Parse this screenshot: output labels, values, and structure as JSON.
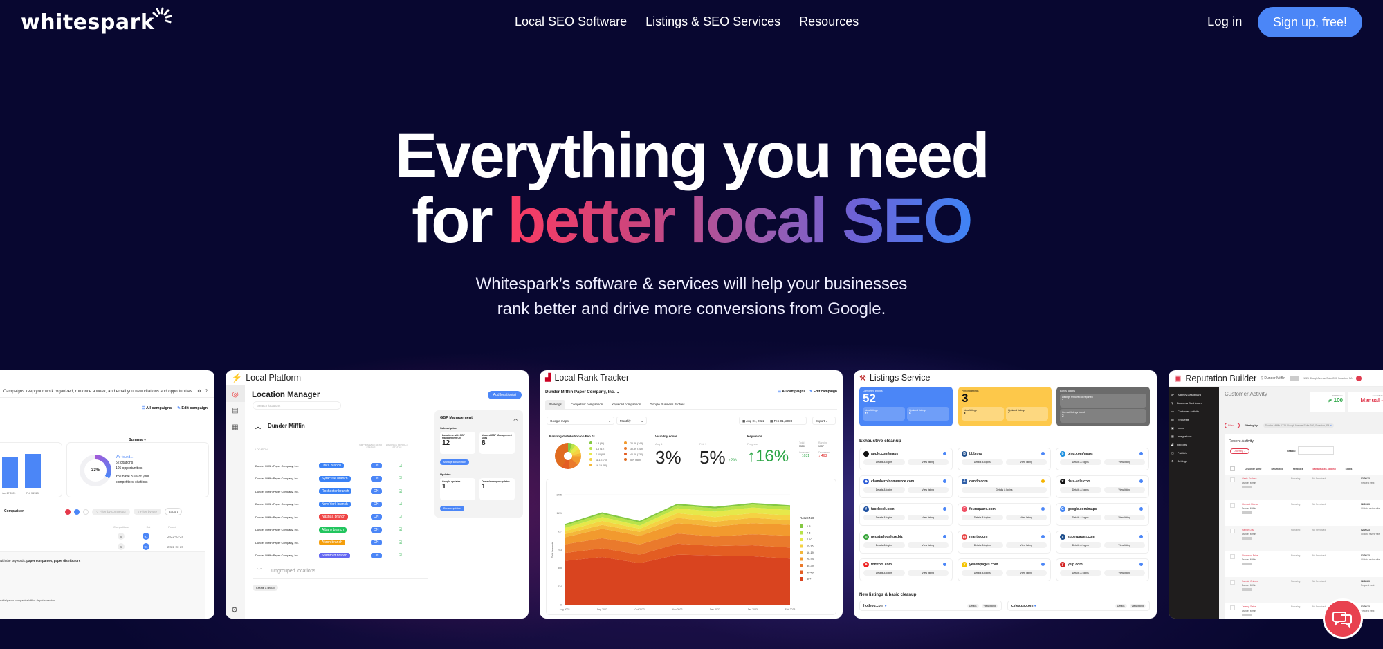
{
  "nav": {
    "logo": "whitespark",
    "menu": [
      "Local SEO Software",
      "Listings & SEO Services",
      "Resources"
    ],
    "login": "Log in",
    "signup": "Sign up, free!"
  },
  "hero": {
    "line1": "Everything you need",
    "line2_plain": "for",
    "line2_grad": "better local SEO",
    "subtitle_1": "Whitespark’s software & services will help your businesses",
    "subtitle_2": "rank better and drive more conversions from Google."
  },
  "colors": {
    "accent": "#4b86f7",
    "background": "#080730",
    "grad_start": "#fb3b62",
    "grad_end": "#3f84f6",
    "chat": "#e8414f"
  },
  "citation_card": {
    "info": "Campaigns keep your work organized, run once a week, and email you new citations and opportunities.",
    "all_campaigns": "All campaigns",
    "edit_campaign": "Edit campaign",
    "summary": "Summary",
    "bars": [
      {
        "label": "Jan 27 2023",
        "value": 47
      },
      {
        "label": "Feb 3 2023",
        "value": 52
      }
    ],
    "donut_pct": "33%",
    "found": "We found...",
    "citations": "52 citations",
    "opportunities": "105 opportunities",
    "compare_1": "You have 33% of your",
    "compare_2": "competitors' citations",
    "comparison": "Comparison",
    "filter_competitor": "Filter by competitor",
    "filter_site": "Filter by site",
    "export": "Export",
    "cols": [
      "Competitors",
      "DA",
      "Found"
    ],
    "rows": [
      {
        "competitors": "8",
        "da": "91",
        "found": "2022-03-28"
      },
      {
        "competitors": "6",
        "da": "91",
        "found": "2022-03-28"
      }
    ],
    "keywords_text": "with the keywords: ",
    "keywords": "paper companies, paper distributors",
    "url": "rofile/paper-companies/office-depot-scranton"
  },
  "local_platform": {
    "title": "Local Platform",
    "heading": "Location Manager",
    "add": "Add location(s)",
    "search": "Search locations",
    "group": "Dunder Mifflin",
    "cols": [
      "LOCATION",
      "GBP MANAGEMENT STATUS",
      "LISTINGS SERVICE STATUS"
    ],
    "rows": [
      {
        "name": "Dunder Mifflin Paper Company, Inc.",
        "branch": "Utica branch",
        "color": "#3b82f6",
        "status": "ON"
      },
      {
        "name": "Dunder Mifflin Paper Company, Inc.",
        "branch": "Syracuse branch",
        "color": "#3b82f6",
        "status": "ON"
      },
      {
        "name": "Dunder Mifflin Paper Company, Inc.",
        "branch": "Rochester branch",
        "color": "#3b82f6",
        "status": "ON"
      },
      {
        "name": "Dunder Mifflin Paper Company, Inc.",
        "branch": "New York branch",
        "color": "#3b82f6",
        "status": "ON"
      },
      {
        "name": "Dunder Mifflin Paper Company, Inc.",
        "branch": "Nashua branch",
        "color": "#ef4444",
        "status": "ON"
      },
      {
        "name": "Dunder Mifflin Paper Company, Inc.",
        "branch": "Albany branch",
        "color": "#22c55e",
        "status": "ON"
      },
      {
        "name": "Dunder Mifflin Paper Company, Inc.",
        "branch": "Akron branch",
        "color": "#f59e0b",
        "status": "ON"
      },
      {
        "name": "Dunder Mifflin Paper Company, Inc.",
        "branch": "Stamford branch",
        "color": "#6366f1",
        "status": "ON"
      }
    ],
    "ungrouped": "Ungrouped locations",
    "create_group": "Create a group",
    "gbp": {
      "title": "GBP Management",
      "subscription": "Subscription",
      "with_label": "Locations with GBP Management ON",
      "with_val": "12",
      "unused_label": "Unused GBP Management slots",
      "unused_val": "8",
      "manage": "Manage subscription",
      "updates": "Updates",
      "google_label": "Google updates",
      "google_val": "1",
      "owner_label": "Owner/manager updates",
      "owner_val": "1",
      "review": "Review updates"
    }
  },
  "rank_tracker": {
    "title": "Local Rank Tracker",
    "company": "Dunder Mifflin Paper Company, Inc.",
    "all_campaigns": "All campaigns",
    "edit_campaign": "Edit campaign",
    "tabs": [
      "Rankings",
      "Competitor comparison",
      "Keyword comparison",
      "Google Business Profiles"
    ],
    "source": "Google maps",
    "period": "Monthly",
    "date_from": "Aug 01, 2022",
    "date_to": "Feb 01, 2023",
    "export": "Export",
    "dist_title": "Ranking distribution on Feb 01",
    "dist": [
      "1-3 (66)",
      "4-6 (61)",
      "7-10 (88)",
      "11-15 (76)",
      "16-19 (52)",
      "20-29 (148)",
      "30-39 (149)",
      "40-49 (134)",
      "50+ (989)"
    ],
    "vis_title": "Visibility score",
    "vis_from_label": "Aug 1",
    "vis_from": "3%",
    "vis_to_label": "Feb 1",
    "vis_to": "5%",
    "vis_delta": "↑2%",
    "kw_title": "Keywords",
    "kw_progress_label": "Progress",
    "kw_progress": "↑16%",
    "total_label": "Total",
    "total": "3550",
    "ranking_label": "Ranking",
    "ranking": "1337",
    "inc_label": "Increased",
    "inc": "↑ 1031",
    "dec_label": "Decreased",
    "dec": "↓ 463"
  },
  "chart_data": {
    "type": "area",
    "title": "",
    "xlabel": "",
    "ylabel": "Total keywords",
    "x": [
      "Aug 2022",
      "Sep 2022",
      "Oct 2022",
      "Nov 2022",
      "Dec 2022",
      "Jan 2023",
      "Feb 2023"
    ],
    "yticks": [
      0,
      234,
      468,
      703,
      937,
      1171,
      1405
    ],
    "ylim": [
      0,
      1405
    ],
    "legend_title": "RANKING",
    "legend_position": "right",
    "series": [
      {
        "name": "50+",
        "color": "#d9441f",
        "values": [
          560,
          610,
          530,
          640,
          630,
          620,
          590
        ]
      },
      {
        "name": "40-49",
        "color": "#e35d22",
        "values": [
          100,
          110,
          110,
          140,
          120,
          140,
          140
        ]
      },
      {
        "name": "30-39",
        "color": "#ea7a2c",
        "values": [
          110,
          130,
          130,
          130,
          120,
          140,
          150
        ]
      },
      {
        "name": "20-29",
        "color": "#f29a2e",
        "values": [
          90,
          120,
          110,
          130,
          130,
          140,
          140
        ]
      },
      {
        "name": "16-19",
        "color": "#f4b73a",
        "values": [
          40,
          50,
          50,
          70,
          60,
          70,
          60
        ]
      },
      {
        "name": "11-15",
        "color": "#f5d243",
        "values": [
          40,
          50,
          40,
          60,
          60,
          60,
          60
        ]
      },
      {
        "name": "7-10",
        "color": "#e6e84a",
        "values": [
          40,
          50,
          40,
          60,
          70,
          70,
          70
        ]
      },
      {
        "name": "4-6",
        "color": "#b8e34a",
        "values": [
          30,
          40,
          40,
          40,
          40,
          40,
          40
        ]
      },
      {
        "name": "1-3",
        "color": "#84c842",
        "values": [
          20,
          20,
          20,
          20,
          20,
          20,
          20
        ]
      }
    ]
  },
  "listings": {
    "title": "Listings Service",
    "completed": {
      "label": "Completed listings",
      "value": "52",
      "new_label": "New listings",
      "new": "43",
      "upd_label": "Updated listings",
      "upd": "9"
    },
    "pending": {
      "label": "Pending listings",
      "value": "3",
      "new_label": "New listings",
      "new": "3",
      "upd_label": "Updated listings",
      "upd": "1"
    },
    "bonus": {
      "label": "Bonus actions",
      "a_label": "Listings removed or reported",
      "a": "1",
      "b_label": "Correct listings found",
      "b": "3"
    },
    "exhaustive": "Exhaustive cleanup",
    "sites": [
      {
        "name": "apple.com/maps",
        "icon": "",
        "color": "#111"
      },
      {
        "name": "bbb.org",
        "icon": "B",
        "color": "#1e4e8c"
      },
      {
        "name": "bing.com/maps",
        "icon": "b",
        "color": "#1a8fe0"
      },
      {
        "name": "chamberofcommerce.com",
        "icon": "◆",
        "color": "#2a5bd7"
      },
      {
        "name": "dandb.com",
        "icon": "&",
        "color": "#2f5fa8"
      },
      {
        "name": "data-axle.com",
        "icon": "✕",
        "color": "#111"
      },
      {
        "name": "facebook.com",
        "icon": "f",
        "color": "#1c4fa0"
      },
      {
        "name": "foursquare.com",
        "icon": "F",
        "color": "#f04e63"
      },
      {
        "name": "google.com/maps",
        "icon": "G",
        "color": "#4285f4"
      },
      {
        "name": "neustarlocaleze.biz",
        "icon": "n",
        "color": "#39a53b"
      },
      {
        "name": "manta.com",
        "icon": "m",
        "color": "#e94b4b"
      },
      {
        "name": "superpages.com",
        "icon": "s",
        "color": "#1e4e8c"
      },
      {
        "name": "tomtom.com",
        "icon": "✦",
        "color": "#e22"
      },
      {
        "name": "yellowpages.com",
        "icon": "y",
        "color": "#f5c400"
      },
      {
        "name": "yelp.com",
        "icon": "y",
        "color": "#d32323"
      }
    ],
    "details": "Details & logins",
    "view": "View listing",
    "basic": "New listings & basic cleanup",
    "basic_sites": [
      {
        "name": "hotfrog.com"
      },
      {
        "name": "cylex.us.com"
      }
    ],
    "basic_details": "Details"
  },
  "reputation": {
    "title": "Reputation Builder",
    "business": "Dunder Mifflin",
    "address": "1725 Slough Avenue Suite 200, Scranton, PA",
    "sidebar": [
      "Agency Dashboard",
      "Business Dashboard",
      "Customer Activity",
      "Requests",
      "Inbox",
      "Integrations",
      "Reports",
      "Publish",
      "Settings"
    ],
    "heading": "Customer Activity",
    "nps_label": "NPS Score",
    "nps": "100",
    "send_label": "Send Mode",
    "send": "Manual",
    "filter": "Filter",
    "filtering": "Filtering by:",
    "filter_val": "Dunder Mifflin 1725 Slough Avenue Suite 200, Scranton, PA",
    "recent": "Recent Activity",
    "order": "Order by",
    "search": "Search:",
    "cols": [
      "Customer Name",
      "NPS/Rating",
      "Feedback",
      "Manage Auto-Tagging",
      "Status"
    ],
    "rows": [
      {
        "name": "Alexis Scalese",
        "rating": "No rating",
        "feedback": "No Feedback",
        "date": "02/09/23",
        "status": "Request sent"
      },
      {
        "name": "Clement Rivera",
        "rating": "No rating",
        "feedback": "No Feedback",
        "date": "02/09/23",
        "status": "Click to review site"
      },
      {
        "name": "Nathan Diaz",
        "rating": "No rating",
        "feedback": "No Feedback",
        "date": "02/09/23",
        "status": "Click to review site"
      },
      {
        "name": "Sherwood Price",
        "rating": "No rating",
        "feedback": "No Feedback",
        "date": "02/08/23",
        "status": "Click to review site"
      },
      {
        "name": "Sahmie Grimes",
        "rating": "No rating",
        "feedback": "No Feedback",
        "date": "02/08/23",
        "status": "Request sent"
      },
      {
        "name": "Jeremy Gates",
        "rating": "No rating",
        "feedback": "No Feedback",
        "date": "02/08/23",
        "status": "Request sent"
      }
    ],
    "sub": "Dunder Mifflin"
  }
}
